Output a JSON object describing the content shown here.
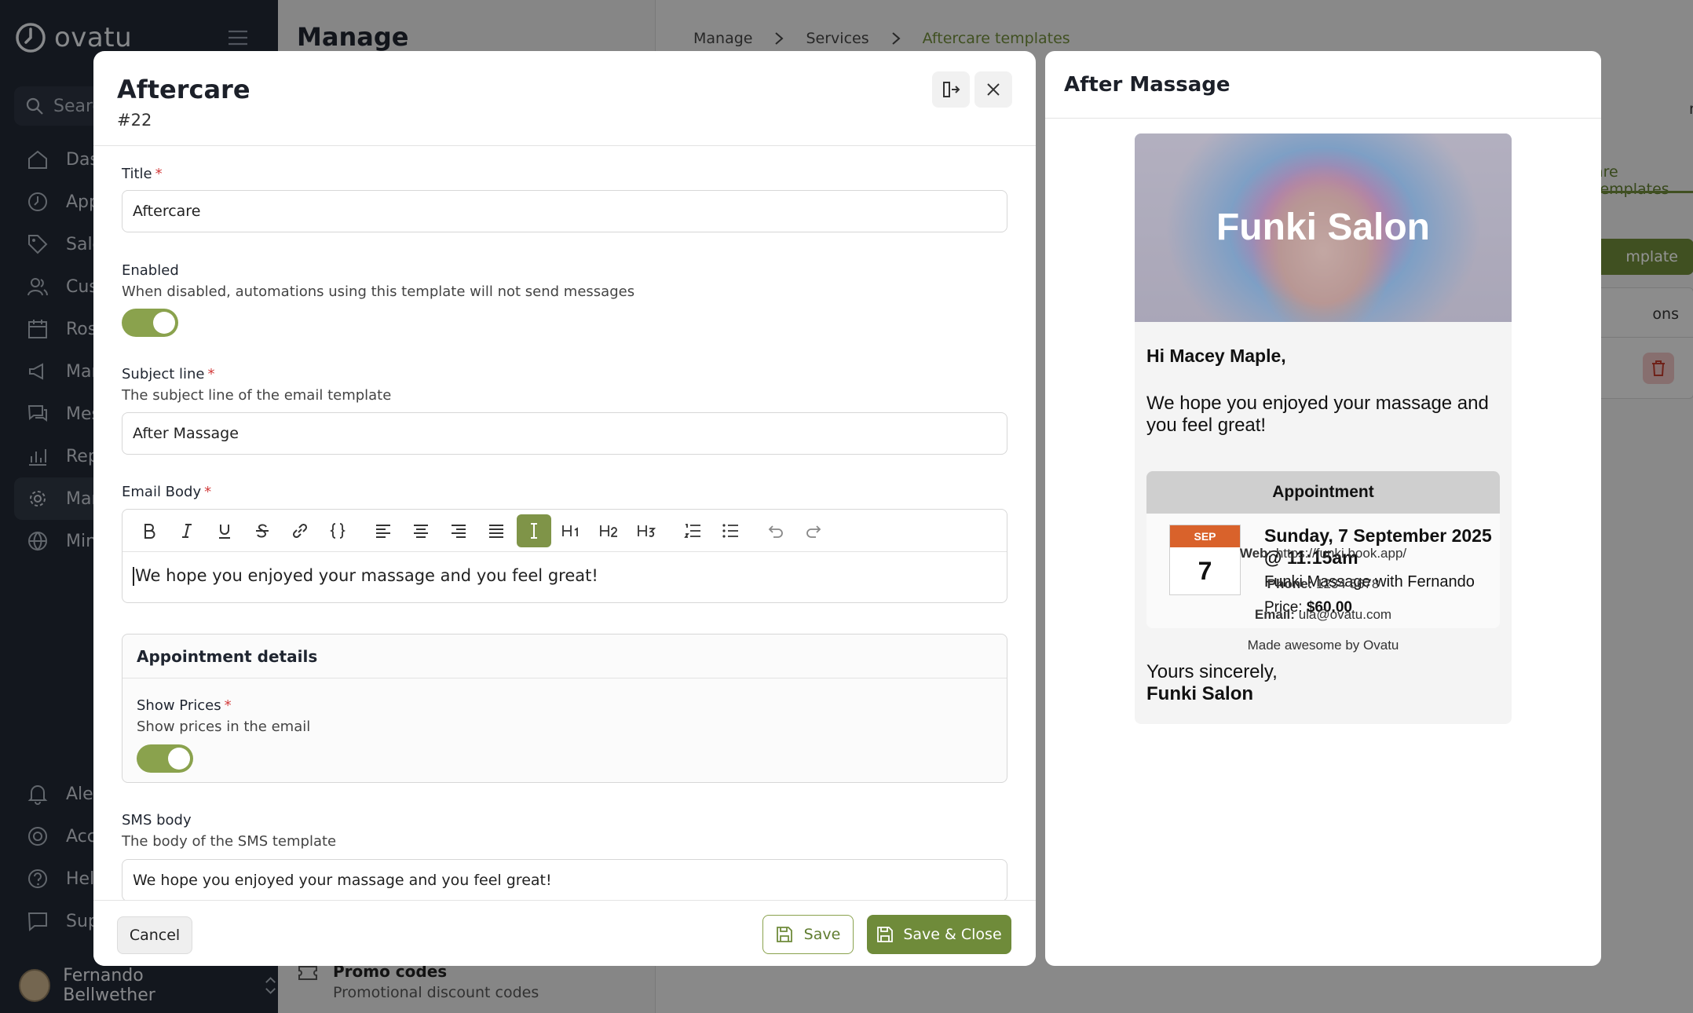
{
  "app": {
    "brand": "ovatu",
    "search_placeholder": "Search",
    "nav": [
      {
        "label": "Dashboard",
        "icon": "home-icon"
      },
      {
        "label": "Appointments",
        "icon": "clock-icon"
      },
      {
        "label": "Sales",
        "icon": "tag-icon"
      },
      {
        "label": "Customers",
        "icon": "users-icon"
      },
      {
        "label": "Roster",
        "icon": "calendar-icon"
      },
      {
        "label": "Marketing",
        "icon": "megaphone-icon"
      },
      {
        "label": "Messages",
        "icon": "chat-icon"
      },
      {
        "label": "Reports",
        "icon": "chart-icon"
      },
      {
        "label": "Manage",
        "icon": "gear-icon"
      },
      {
        "label": "Mini sites",
        "icon": "globe-icon"
      }
    ],
    "nav_bottom": [
      {
        "label": "Alerts",
        "icon": "bell-icon"
      },
      {
        "label": "Account",
        "icon": "account-icon"
      },
      {
        "label": "Help",
        "icon": "help-icon"
      },
      {
        "label": "Support",
        "icon": "support-icon"
      }
    ],
    "user_name": "Fernando Bellwether"
  },
  "manage_panel": {
    "title": "Manage",
    "promo_title": "Promo codes",
    "promo_sub": "Promotional discount codes"
  },
  "breadcrumb": [
    "Manage",
    "Services",
    "Aftercare templates"
  ],
  "bg_fragments": {
    "tab": "are templates",
    "button": "mplate",
    "col": "ons",
    "frag": "n"
  },
  "editor": {
    "title": "Aftercare",
    "id": "#22",
    "title_label": "Title",
    "title_value": "Aftercare",
    "enabled_label": "Enabled",
    "enabled_help": "When disabled, automations using this template will not send messages",
    "enabled": true,
    "subject_label": "Subject line",
    "subject_help": "The subject line of the email template",
    "subject_value": "After Massage",
    "body_label": "Email Body",
    "body_text": "We hope you enjoyed your massage and you feel great!",
    "toolbar": [
      "bold",
      "italic",
      "underline",
      "strike",
      "link",
      "code",
      "align-left",
      "align-center",
      "align-right",
      "justify",
      "italic-active",
      "H1",
      "H2",
      "H3",
      "ordered-list",
      "bullet-list",
      "undo",
      "redo"
    ],
    "appt_section": "Appointment details",
    "show_prices_label": "Show Prices",
    "show_prices_help": "Show prices in the email",
    "show_prices": true,
    "sms_label": "SMS body",
    "sms_help": "The body of the SMS template",
    "sms_value": "We hope you enjoyed your massage and you feel great!",
    "cancel": "Cancel",
    "save": "Save",
    "save_close": "Save & Close"
  },
  "preview": {
    "title": "After Massage",
    "hero_title": "Funki Salon",
    "greeting": "Hi Macey Maple,",
    "message": "We hope you enjoyed your massage and you feel great!",
    "appt_header": "Appointment",
    "cal_month": "SEP",
    "cal_day": "7",
    "when": "Sunday, 7 September 2025 @ 11:15am",
    "service": "Funki Massage with Fernando",
    "price_label": "Price:",
    "price_value": "$60.00",
    "signoff": "Yours sincerely,",
    "signoff_name": "Funki Salon",
    "web_label": "Web:",
    "web_value": "https://funki.book.app/",
    "phone_label": "Phone:",
    "phone_value": "1234 5678",
    "email_label": "Email:",
    "email_value": "ula@ovatu.com",
    "made_by": "Made awesome by Ovatu"
  },
  "colors": {
    "accent": "#6f8b3a",
    "sidebar": "#222834",
    "calendar_month": "#d9622b",
    "required": "#d23b3b"
  }
}
